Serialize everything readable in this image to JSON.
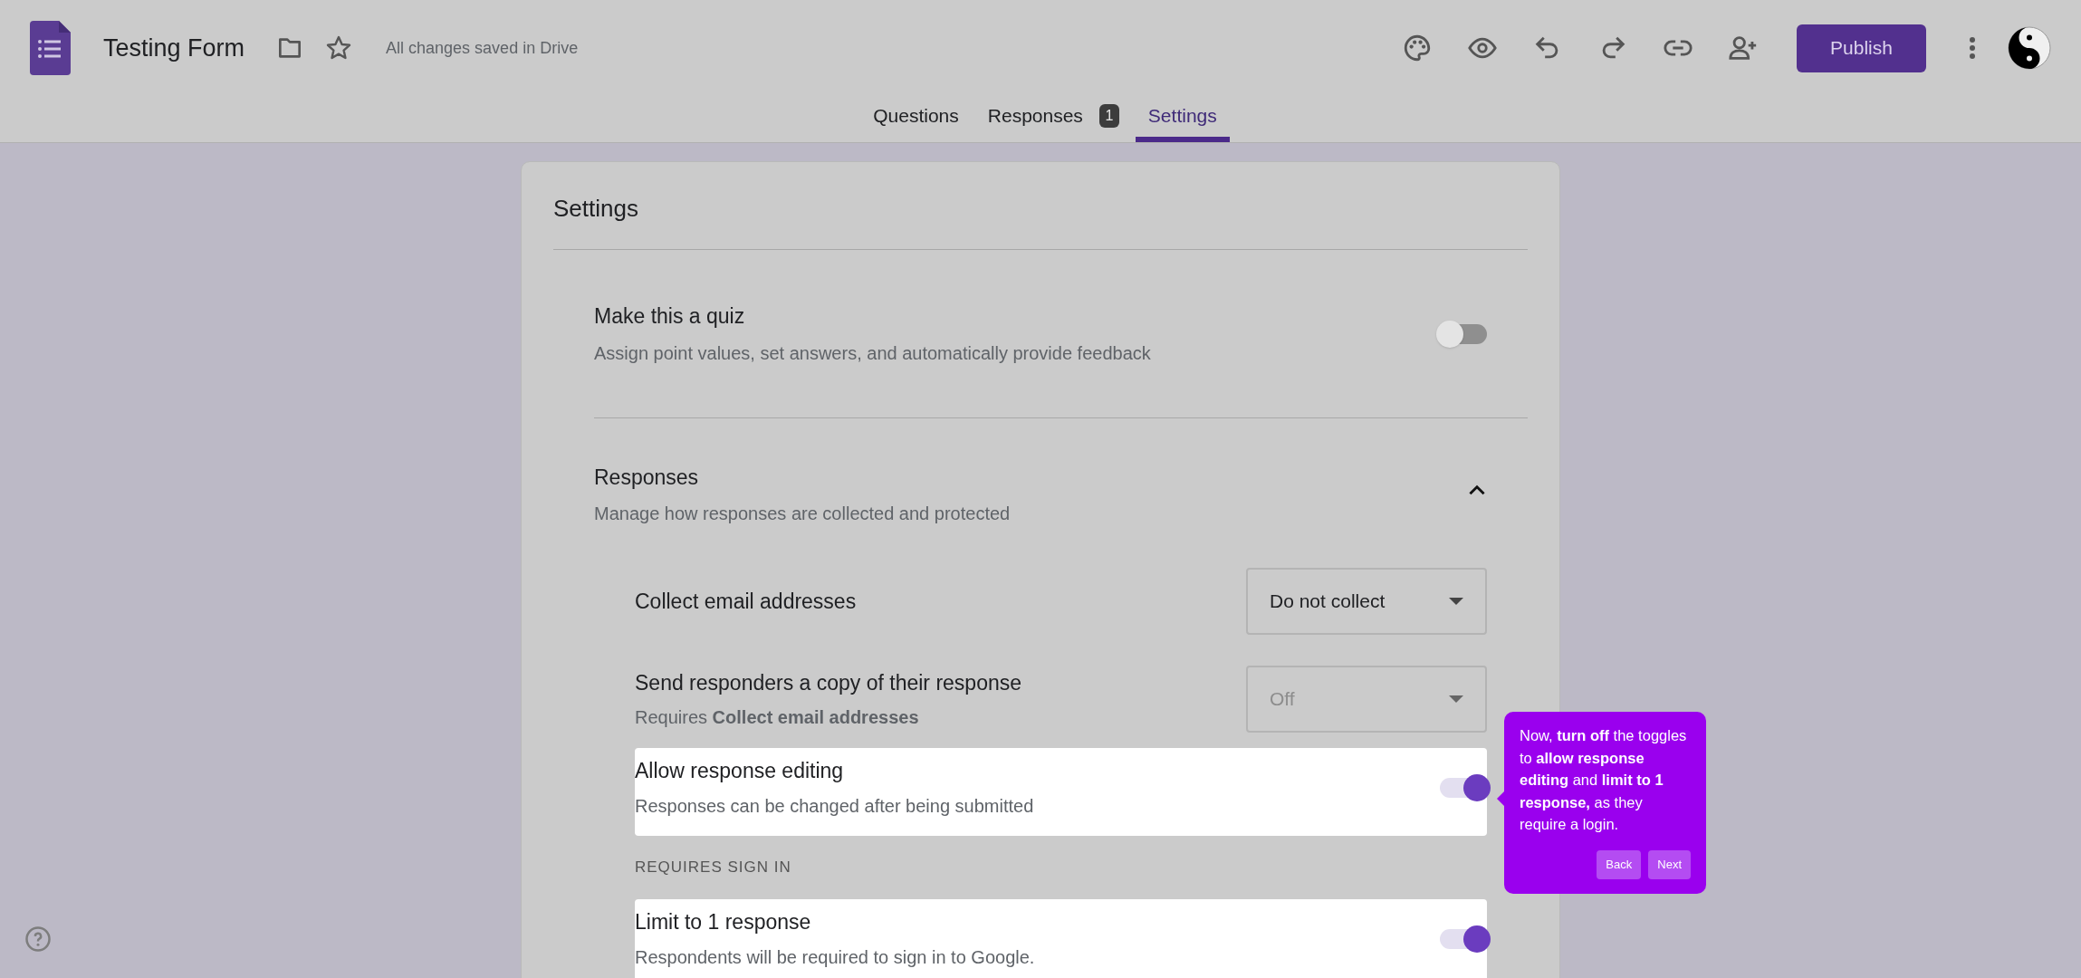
{
  "header": {
    "title": "Testing Form",
    "save_status": "All changes saved in Drive",
    "publish_label": "Publish"
  },
  "tabs": [
    {
      "label": "Questions",
      "selected": false
    },
    {
      "label": "Responses",
      "selected": false,
      "badge": "1"
    },
    {
      "label": "Settings",
      "selected": true
    }
  ],
  "settings": {
    "title": "Settings",
    "quiz": {
      "title": "Make this a quiz",
      "subtitle": "Assign point values, set answers, and automatically provide feedback",
      "on": false
    },
    "responses": {
      "title": "Responses",
      "subtitle": "Manage how responses are collected and protected",
      "expanded": true,
      "items": [
        {
          "kind": "select",
          "title": "Collect email addresses",
          "value": "Do not collect",
          "disabled": false,
          "highlighted": false
        },
        {
          "kind": "select",
          "title": "Send responders a copy of their response",
          "subtitle": "Requires **Collect email addresses**",
          "value": "Off",
          "disabled": true,
          "highlighted": false
        },
        {
          "kind": "toggle",
          "title": "Allow response editing",
          "subtitle": "Responses can be changed after being submitted",
          "on": true,
          "highlighted": true
        },
        {
          "kind": "label",
          "title": "REQUIRES SIGN IN"
        },
        {
          "kind": "toggle",
          "title": "Limit to 1 response",
          "subtitle": "Respondents will be required to sign in to Google.",
          "on": true,
          "highlighted": true
        }
      ]
    }
  },
  "tooltip": {
    "text": "Now, **turn off** the toggles to **allow response editing** and **limit to 1 response,** as they require a login.",
    "buttons": [
      "Back",
      "Next"
    ]
  }
}
